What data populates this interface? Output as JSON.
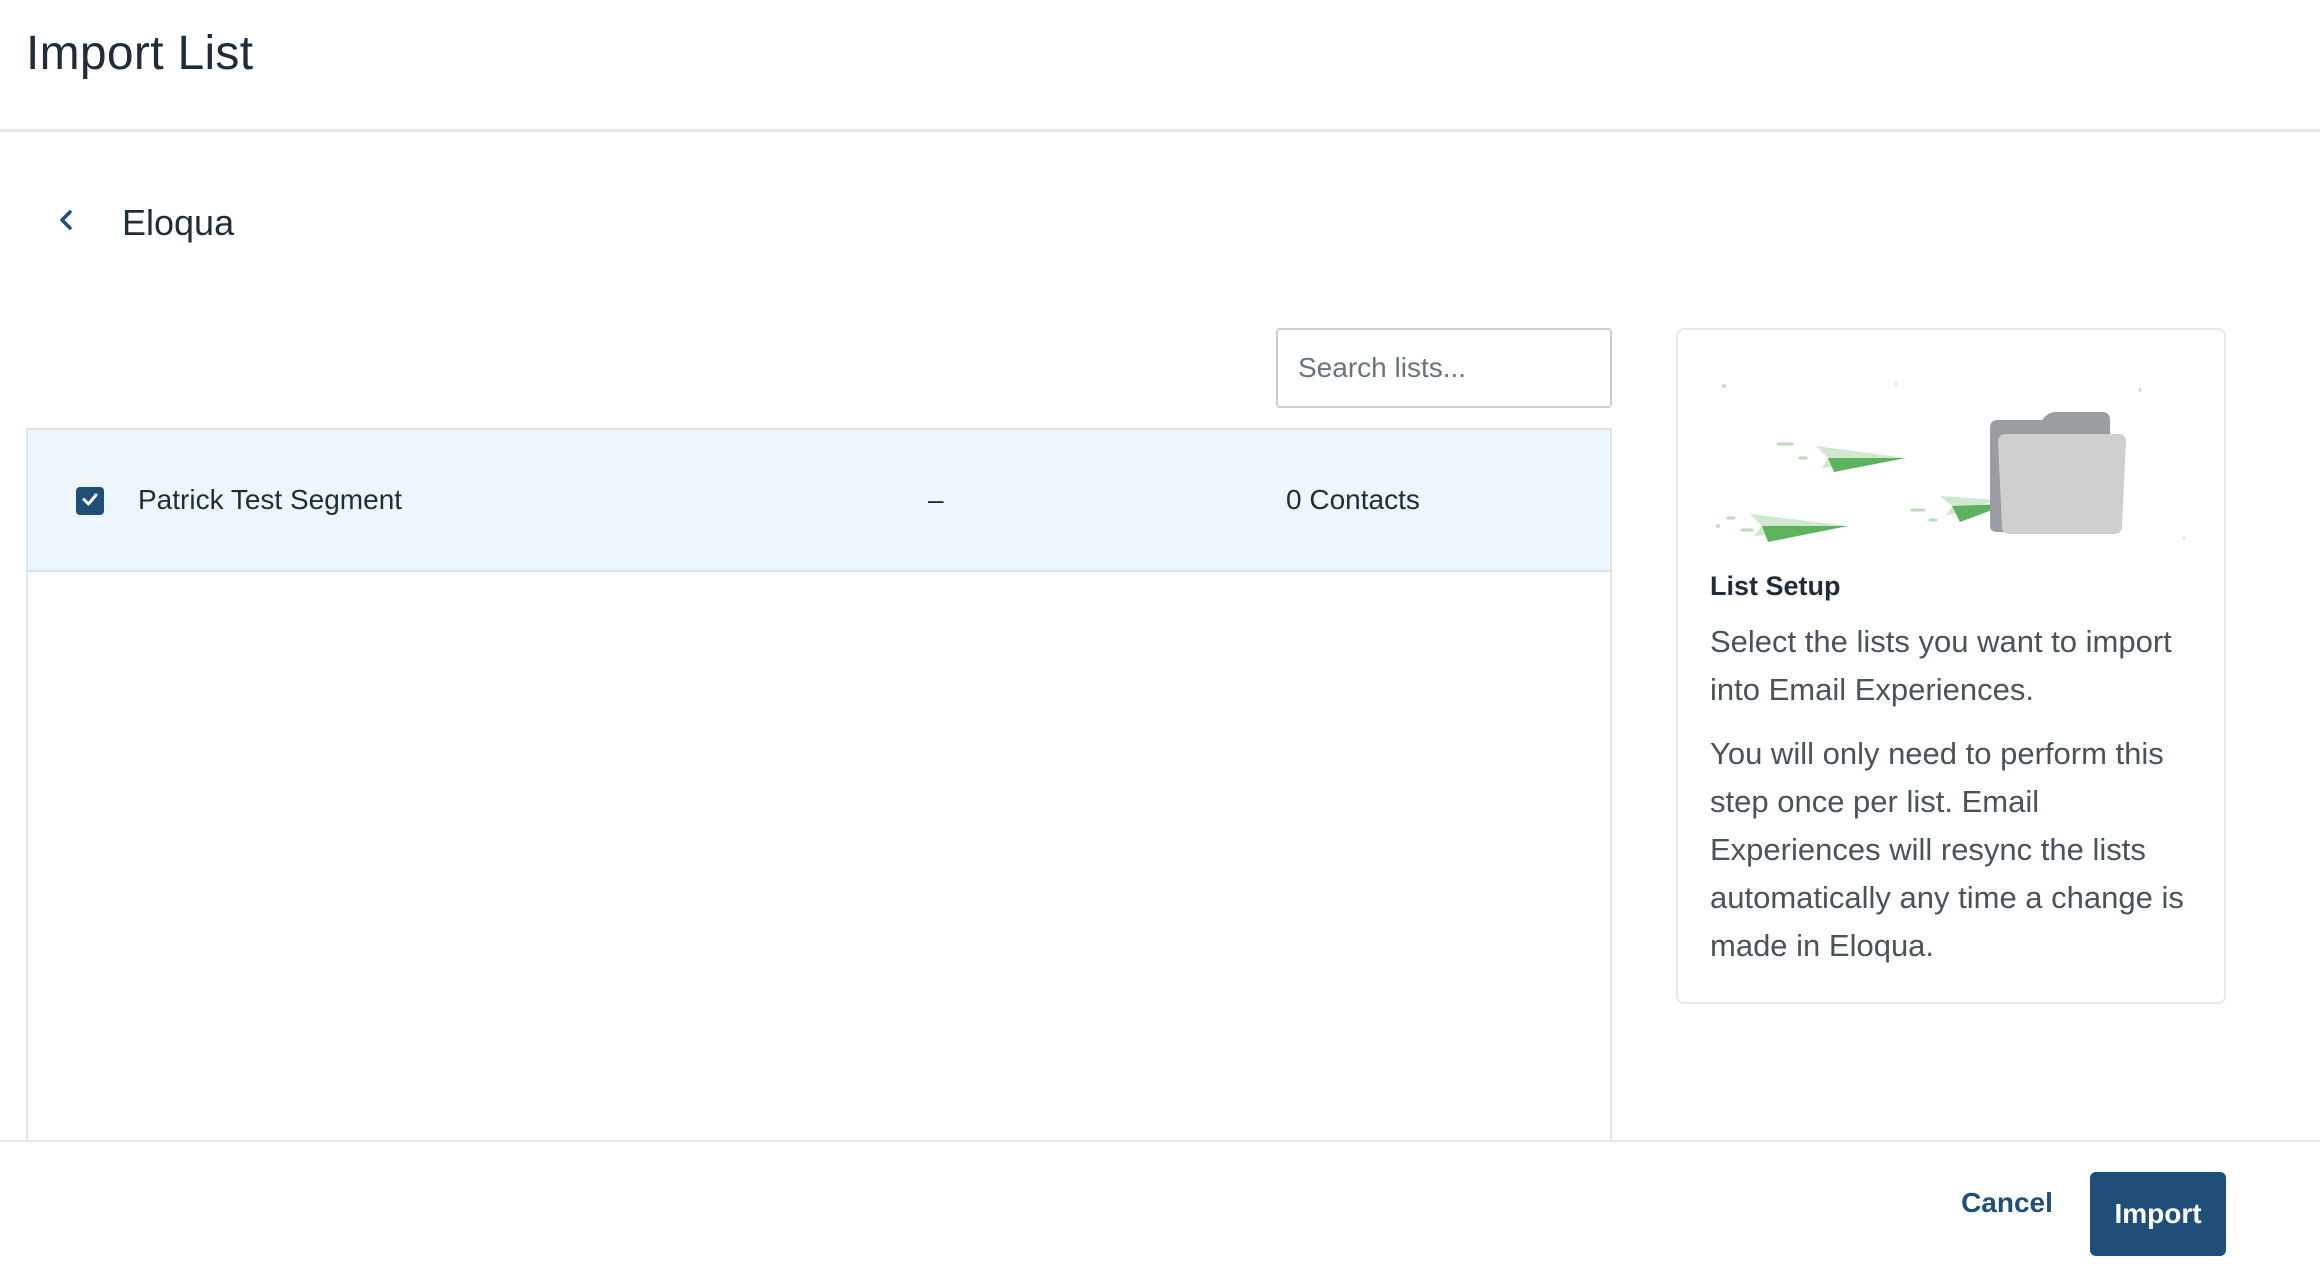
{
  "header": {
    "title": "Import List"
  },
  "source": {
    "back_icon": "chevron-left-icon",
    "title": "Eloqua"
  },
  "search": {
    "placeholder": "Search lists...",
    "value": ""
  },
  "lists": {
    "rows": [
      {
        "checked": true,
        "name": "Patrick Test Segment",
        "middle": "–",
        "contacts": "0 Contacts"
      }
    ]
  },
  "info_card": {
    "illustration": "paper-planes-folder-illustration",
    "heading": "List Setup",
    "paragraph_1": "Select the lists you want to import into Email Experiences.",
    "paragraph_2": "You will only need to perform this step once per list. Email Experiences will resync the lists automatically any time a change is made in Eloqua."
  },
  "footer": {
    "cancel_label": "Cancel",
    "import_label": "Import"
  },
  "colors": {
    "primary": "#1f4e79",
    "row_selected_bg": "#edf6fc",
    "plane_green": "#5cb25d"
  }
}
